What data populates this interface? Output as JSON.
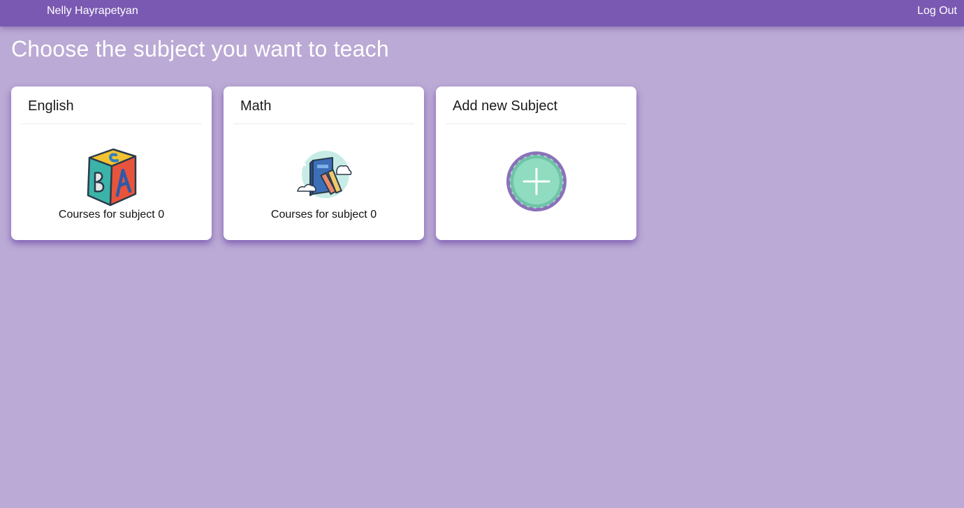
{
  "header": {
    "user_name": "Nelly Hayrapetyan",
    "logout_label": "Log Out"
  },
  "page": {
    "title": "Choose the subject you want to teach"
  },
  "subjects": [
    {
      "title": "English",
      "caption": "Courses for subject 0",
      "icon": "abc-block-icon"
    },
    {
      "title": "Math",
      "caption": "Courses for subject 0",
      "icon": "math-book-icon"
    }
  ],
  "add_subject": {
    "title": "Add new Subject",
    "icon": "plus-circle-icon"
  },
  "colors": {
    "header_bg": "#7a59b2",
    "page_bg": "#bbaad5",
    "card_bg": "#ffffff",
    "add_icon_fill": "#8fdcc0",
    "add_icon_ring": "#8a72b8"
  }
}
